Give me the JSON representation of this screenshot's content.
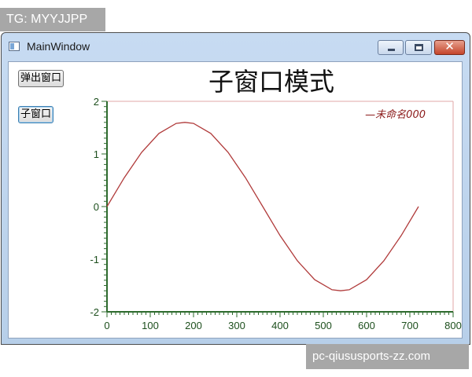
{
  "watermarks": {
    "top": "TG: MYYJJPP",
    "bottom": "pc-qiususports-zz.com"
  },
  "window": {
    "title": "MainWindow",
    "close_glyph": "✕"
  },
  "buttons": {
    "popup_label": "弹出窗口",
    "child_label": "子窗口"
  },
  "chart_data": {
    "type": "line",
    "title": "子窗口模式",
    "xlabel": "",
    "ylabel": "",
    "xlim": [
      0,
      800
    ],
    "ylim": [
      -2,
      2
    ],
    "x_ticks": [
      0,
      100,
      200,
      300,
      400,
      500,
      600,
      700,
      800
    ],
    "y_ticks": [
      -2,
      -1,
      0,
      1,
      2
    ],
    "grid": false,
    "legend_position": "top-right",
    "series": [
      {
        "name": "—未命名000",
        "color": "#b03a3a",
        "x": [
          0,
          40,
          80,
          120,
          160,
          180,
          200,
          240,
          280,
          320,
          360,
          400,
          440,
          480,
          520,
          540,
          560,
          600,
          640,
          680,
          720
        ],
        "y": [
          0,
          0.55,
          1.03,
          1.39,
          1.58,
          1.6,
          1.58,
          1.39,
          1.03,
          0.55,
          0,
          -0.55,
          -1.03,
          -1.39,
          -1.58,
          -1.6,
          -1.58,
          -1.39,
          -1.03,
          -0.55,
          0
        ]
      }
    ]
  },
  "colors": {
    "axis": "#2e6b2e",
    "frame": "#e0a7a7",
    "titlebar": "#c7dbf2"
  }
}
